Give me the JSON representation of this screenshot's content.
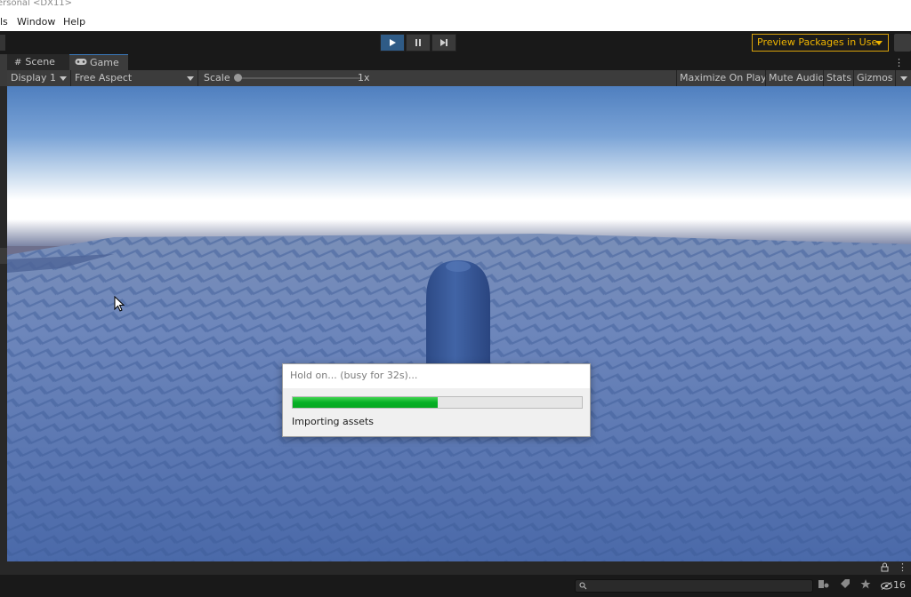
{
  "window": {
    "title": "ersonal <DX11>"
  },
  "menu": {
    "items": [
      {
        "label": "ls"
      },
      {
        "label": "Window"
      },
      {
        "label": "Help"
      }
    ]
  },
  "toolbar": {
    "play_icon": "play-icon",
    "pause_icon": "pause-icon",
    "step_icon": "step-icon",
    "preview_packages_label": "Preview Packages in Use",
    "accent_color": "#f0b500"
  },
  "tabs": {
    "scene_label": "Scene",
    "game_label": "Game",
    "menu_label": "⋮"
  },
  "game_controls": {
    "display_label": "Display 1",
    "aspect_label": "Free Aspect",
    "scale_label": "Scale",
    "scale_value": "1x",
    "scale_slider_fraction": 0.0,
    "maximize_label": "Maximize On Play",
    "mute_label": "Mute Audio",
    "stats_label": "Stats",
    "gizmos_label": "Gizmos"
  },
  "dialog": {
    "title": "Hold on... (busy for 32s)...",
    "progress_fraction": 0.5,
    "message": "Importing assets",
    "progress_color": "#06b025"
  },
  "statusbar": {
    "search_placeholder": "",
    "hidden_count": "16"
  }
}
